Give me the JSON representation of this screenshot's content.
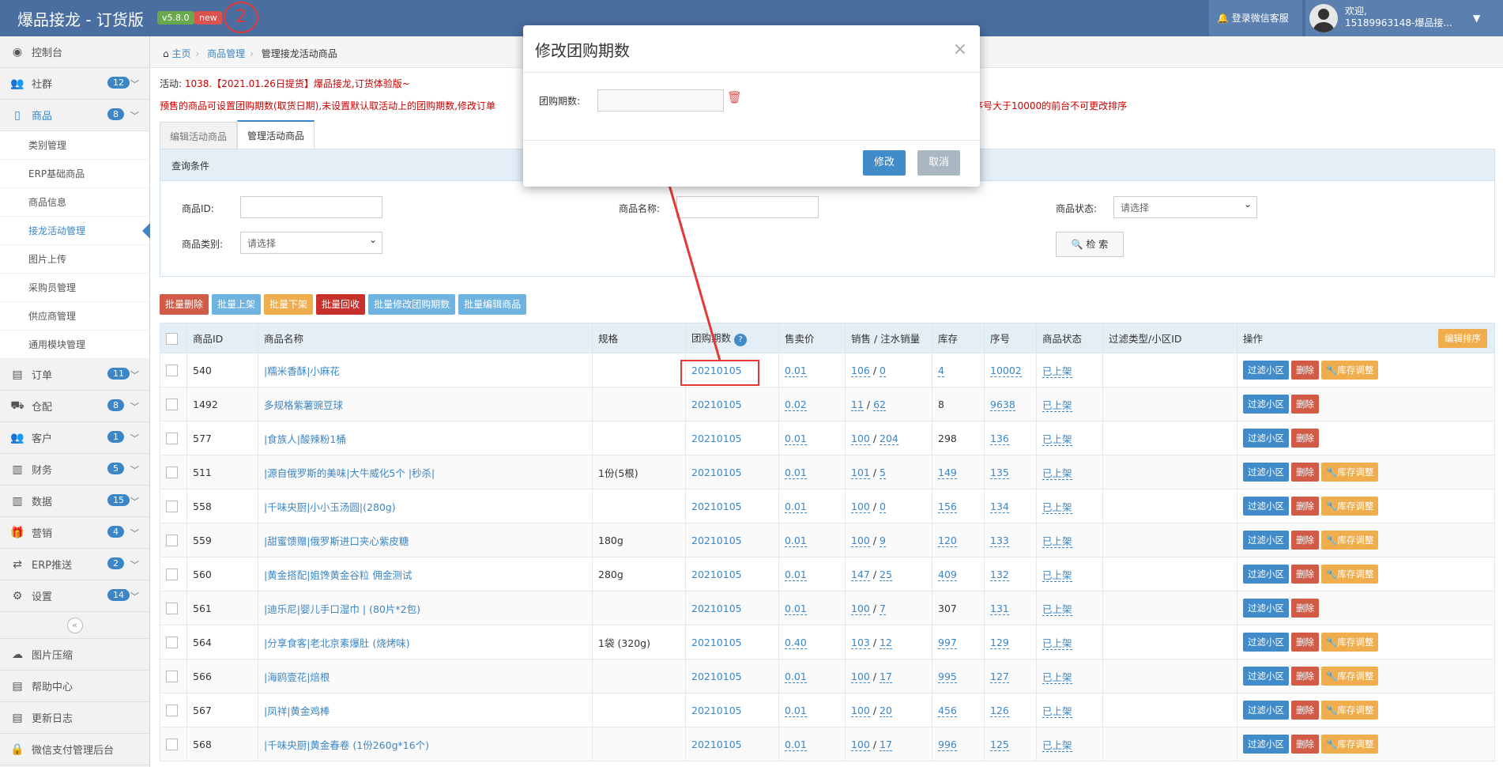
{
  "app": {
    "title": "爆品接龙 - 订货版",
    "version": "v5.8.0",
    "new_label": "new",
    "annotation_number": "2"
  },
  "topbar": {
    "login_wechat": "登录微信客服",
    "welcome": "欢迎,",
    "user": "15189963148-爆品接..."
  },
  "sidebar": {
    "items": [
      {
        "label": "控制台",
        "icon": "dashboard-icon"
      },
      {
        "label": "社群",
        "badge": "12",
        "icon": "users-icon"
      },
      {
        "label": "商品",
        "badge": "8",
        "icon": "file-icon"
      },
      {
        "label": "订单",
        "badge": "11",
        "icon": "book-icon"
      },
      {
        "label": "仓配",
        "badge": "8",
        "icon": "truck-icon"
      },
      {
        "label": "客户",
        "badge": "1",
        "icon": "users-icon"
      },
      {
        "label": "财务",
        "badge": "5",
        "icon": "chart-icon"
      },
      {
        "label": "数据",
        "badge": "15",
        "icon": "chart-icon"
      },
      {
        "label": "营销",
        "badge": "4",
        "icon": "gift-icon"
      },
      {
        "label": "ERP推送",
        "badge": "2",
        "icon": "exchange-icon"
      },
      {
        "label": "设置",
        "badge": "14",
        "icon": "gears-icon"
      },
      {
        "label": "图片压缩",
        "icon": "cloud-icon"
      },
      {
        "label": "帮助中心",
        "icon": "book-icon"
      },
      {
        "label": "更新日志",
        "icon": "book-icon"
      },
      {
        "label": "微信支付管理后台",
        "icon": "lock-icon"
      }
    ],
    "sub": [
      "类别管理",
      "ERP基础商品",
      "商品信息",
      "接龙活动管理",
      "图片上传",
      "采购员管理",
      "供应商管理",
      "通用模块管理"
    ]
  },
  "breadcrumb": {
    "home": "主页",
    "level1": "商品管理",
    "current": "管理接龙活动商品"
  },
  "notices": {
    "activity_prefix": "活动: ",
    "activity": "1038.【2021.01.26日提货】爆品接龙,订货体验版~",
    "line2": "预售的商品可设置团购期数(取货日期),未设置默认取活动上的团购期数,修改订单",
    "line3": "序号大于10000的前台不可更改排序"
  },
  "tabs": [
    "编辑活动商品",
    "管理活动商品"
  ],
  "query": {
    "title": "查询条件",
    "product_id_label": "商品ID:",
    "product_name_label": "商品名称:",
    "product_status_label": "商品状态:",
    "status_value": "请选择",
    "category_label": "商品类别:",
    "category_value": "请选择",
    "search_button": "检 索"
  },
  "bulk": [
    "批量删除",
    "批量上架",
    "批量下架",
    "批量回收",
    "批量修改团购期数",
    "批量编辑商品"
  ],
  "table": {
    "headers": [
      "商品ID",
      "商品名称",
      "规格",
      "团购期数",
      "售卖价",
      "销售 / 注水销量",
      "库存",
      "序号",
      "商品状态",
      "过滤类型/小区ID",
      "操作"
    ],
    "sort_button": "编辑排序",
    "ops": {
      "filter": "过滤小区",
      "delete": "删除",
      "stock": "库存调整"
    },
    "rows": [
      {
        "id": "540",
        "name": "|糯米香酥|小麻花",
        "spec": "",
        "period": "20210105",
        "price": "0.01",
        "sold": "106",
        "fake": "0",
        "stock": "4",
        "stock_link": true,
        "seq": "10002",
        "status": "已上架",
        "stock_btn": true
      },
      {
        "id": "1492",
        "name": "多规格紫薯豌豆球",
        "spec": "",
        "period": "20210105",
        "price": "0.02",
        "sold": "11",
        "fake": "62",
        "stock": "8",
        "stock_link": false,
        "seq": "9638",
        "status": "已上架",
        "stock_btn": false
      },
      {
        "id": "577",
        "name": "|食族人|酸辣粉1桶",
        "spec": "",
        "period": "20210105",
        "price": "0.01",
        "sold": "100",
        "fake": "204",
        "stock": "298",
        "stock_link": false,
        "seq": "136",
        "status": "已上架",
        "stock_btn": false
      },
      {
        "id": "511",
        "name": "|源自俄罗斯的美味|大牛威化5个 |秒杀|",
        "spec": "1份(5根)",
        "period": "20210105",
        "price": "0.01",
        "sold": "101",
        "fake": "5",
        "stock": "149",
        "stock_link": true,
        "seq": "135",
        "status": "已上架",
        "stock_btn": true
      },
      {
        "id": "558",
        "name": "|千味央厨|小小玉汤圆|(280g)",
        "spec": "",
        "period": "20210105",
        "price": "0.01",
        "sold": "100",
        "fake": "0",
        "stock": "156",
        "stock_link": true,
        "seq": "134",
        "status": "已上架",
        "stock_btn": true
      },
      {
        "id": "559",
        "name": "|甜蜜馈赠|俄罗斯进口夹心紫皮糖",
        "spec": "180g",
        "period": "20210105",
        "price": "0.01",
        "sold": "100",
        "fake": "9",
        "stock": "120",
        "stock_link": true,
        "seq": "133",
        "status": "已上架",
        "stock_btn": true
      },
      {
        "id": "560",
        "name": "|黄金搭配|姐馋黄金谷粒 佣金测试",
        "spec": "280g",
        "period": "20210105",
        "price": "0.01",
        "sold": "147",
        "fake": "25",
        "stock": "409",
        "stock_link": true,
        "seq": "132",
        "status": "已上架",
        "stock_btn": true
      },
      {
        "id": "561",
        "name": "|迪乐尼|婴儿手口湿巾 | (80片*2包)",
        "spec": "",
        "period": "20210105",
        "price": "0.01",
        "sold": "100",
        "fake": "7",
        "stock": "307",
        "stock_link": false,
        "seq": "131",
        "status": "已上架",
        "stock_btn": false
      },
      {
        "id": "564",
        "name": "|分享食客|老北京素爆肚 (烧烤味)",
        "spec": "1袋 (320g)",
        "period": "20210105",
        "price": "0.40",
        "sold": "103",
        "fake": "12",
        "stock": "997",
        "stock_link": true,
        "seq": "129",
        "status": "已上架",
        "stock_btn": true
      },
      {
        "id": "566",
        "name": "|海鸥壹花|焙根",
        "spec": "",
        "period": "20210105",
        "price": "0.01",
        "sold": "100",
        "fake": "17",
        "stock": "995",
        "stock_link": true,
        "seq": "127",
        "status": "已上架",
        "stock_btn": true
      },
      {
        "id": "567",
        "name": "|凤祥|黄金鸡棒",
        "spec": "",
        "period": "20210105",
        "price": "0.01",
        "sold": "100",
        "fake": "20",
        "stock": "456",
        "stock_link": true,
        "seq": "126",
        "status": "已上架",
        "stock_btn": true
      },
      {
        "id": "568",
        "name": "|千味央厨|黄金春卷 (1份260g*16个)",
        "spec": "",
        "period": "20210105",
        "price": "0.01",
        "sold": "100",
        "fake": "17",
        "stock": "996",
        "stock_link": true,
        "seq": "125",
        "status": "已上架",
        "stock_btn": true
      }
    ]
  },
  "modal": {
    "title": "修改团购期数",
    "label": "团购期数:",
    "input_value": "",
    "confirm": "修改",
    "cancel": "取消",
    "close": "×"
  },
  "colors": {
    "topbar": "#4a6ea0",
    "primary": "#428bca",
    "danger": "#d15b47",
    "warning": "#f0ad4e",
    "annotation": "#e53935"
  }
}
